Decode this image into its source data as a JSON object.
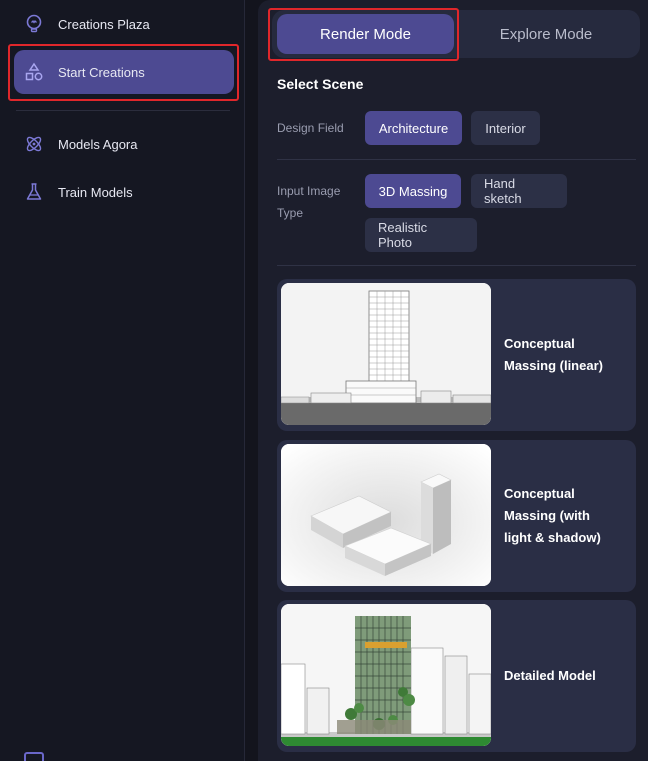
{
  "sidebar": {
    "items": [
      {
        "label": "Creations Plaza",
        "icon": "lightbulb-icon"
      },
      {
        "label": "Start Creations",
        "icon": "shapes-icon",
        "active": true
      },
      {
        "label": "Models Agora",
        "icon": "atom-icon"
      },
      {
        "label": "Train Models",
        "icon": "flask-icon"
      }
    ]
  },
  "modes": {
    "render": "Render Mode",
    "explore": "Explore Mode",
    "selected": "Render Mode"
  },
  "scene": {
    "title": "Select Scene",
    "design_field": {
      "label": "Design Field",
      "options": [
        "Architecture",
        "Interior"
      ],
      "selected": "Architecture"
    },
    "input_image_type": {
      "label_line1": "Input Image",
      "label_line2": "Type",
      "options": [
        "3D Massing",
        "Hand sketch",
        "Realistic Photo"
      ],
      "selected": "3D Massing"
    },
    "cards": [
      {
        "line1": "Conceptual",
        "line2": "Massing (linear)",
        "line3": ""
      },
      {
        "line1": "Conceptual",
        "line2": "Massing (with",
        "line3": "light & shadow)"
      },
      {
        "line1": "Detailed Model",
        "line2": "",
        "line3": ""
      }
    ]
  },
  "colors": {
    "accent": "#4d4a92",
    "background": "#13141d",
    "panel": "#1c1e2c",
    "highlight": "#e0272b"
  }
}
